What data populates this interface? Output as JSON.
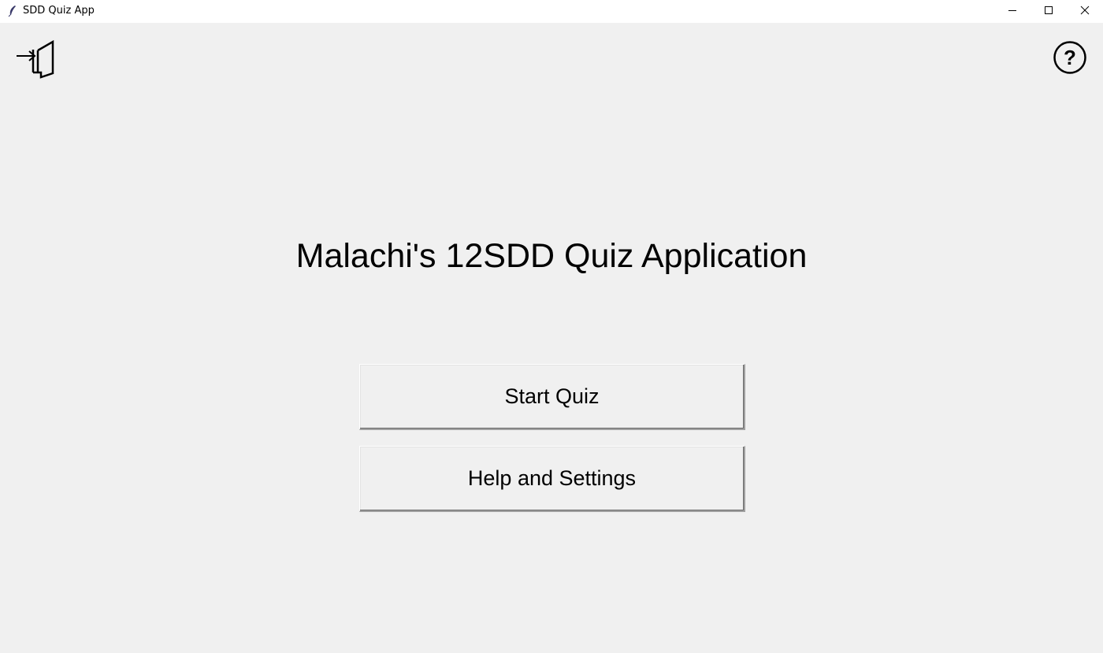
{
  "window": {
    "title": "SDD Quiz App"
  },
  "icons": {
    "app": "feather-icon",
    "exit": "exit-door-icon",
    "help": "question-circle-icon",
    "minimize": "minimize-icon",
    "maximize": "maximize-icon",
    "close": "close-icon"
  },
  "main": {
    "title": "Malachi's 12SDD Quiz Application",
    "start_label": "Start Quiz",
    "help_settings_label": "Help and Settings"
  },
  "colors": {
    "background": "#f0f0f0",
    "titlebar": "#ffffff",
    "text": "#000000"
  }
}
